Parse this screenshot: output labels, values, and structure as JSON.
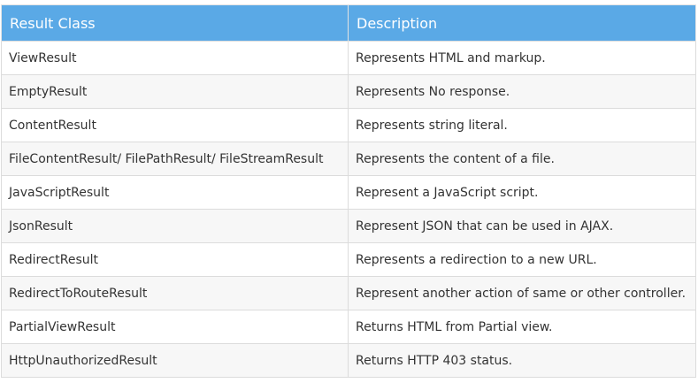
{
  "table": {
    "headers": [
      "Result Class",
      "Description"
    ],
    "rows": [
      [
        "ViewResult",
        "Represents HTML and markup."
      ],
      [
        "EmptyResult",
        "Represents No response."
      ],
      [
        "ContentResult",
        "Represents string literal."
      ],
      [
        "FileContentResult/ FilePathResult/ FileStreamResult",
        "Represents the content of a file."
      ],
      [
        "JavaScriptResult",
        "Represent a JavaScript script."
      ],
      [
        "JsonResult",
        "Represent JSON that can be used in AJAX."
      ],
      [
        "RedirectResult",
        "Represents a redirection to a new URL."
      ],
      [
        "RedirectToRouteResult",
        "Represent another action of same or other controller."
      ],
      [
        "PartialViewResult",
        "Returns HTML from Partial view."
      ],
      [
        "HttpUnauthorizedResult",
        "Returns HTTP 403 status."
      ]
    ]
  },
  "colors": {
    "header_bg": "#5aa9e6",
    "header_text": "#ffffff",
    "row_alt_bg": "#f7f7f7"
  }
}
